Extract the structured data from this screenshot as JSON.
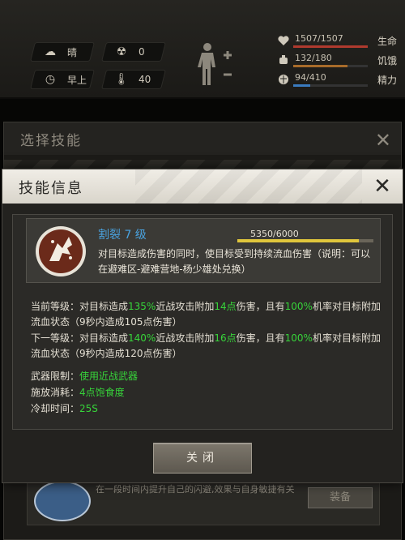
{
  "hud": {
    "weather": "晴",
    "radiation": "0",
    "time_of_day": "早上",
    "temperature": "40",
    "vitals": [
      {
        "label": "生命",
        "value": "1507/1507",
        "fill_fraction": 1.0,
        "color": "#b03a2e"
      },
      {
        "label": "饥饿",
        "value": "132/180",
        "fill_fraction": 0.733,
        "color": "#a86b2a"
      },
      {
        "label": "精力",
        "value": "94/410",
        "fill_fraction": 0.229,
        "color": "#3a7bbf"
      }
    ]
  },
  "background_dialog": {
    "title": "选择技能",
    "skill_desc": "在一段时间内提升自己的闪避,效果与自身敏捷有关",
    "equip_label": "装备"
  },
  "dialog": {
    "title": "技能信息",
    "skill_name": "割裂 7 级",
    "xp_text": "5350/6000",
    "xp_fraction": 0.892,
    "description": "对目标造成伤害的同时，使目标受到持续流血伤害（说明：可以在避难区-避难营地-杨少雄处兑换）",
    "current": {
      "label": "当前等级：",
      "p1": "对目标造成",
      "pct": "135%",
      "p2": "近战攻击附加",
      "dmg": "14点",
      "p3": "伤害，且有",
      "chance": "100%",
      "p4": "机率对目标附加流血状态（9秒内造成105点伤害）"
    },
    "next": {
      "label": "下一等级：",
      "p1": "对目标造成",
      "pct": "140%",
      "p2": "近战攻击附加",
      "dmg": "16点",
      "p3": "伤害，且有",
      "chance": "100%",
      "p4": "机率对目标附加流血状态（9秒内造成120点伤害）"
    },
    "weapon_label": "武器限制：",
    "weapon_value": "使用近战武器",
    "cost_label": "施放消耗：",
    "cost_value": "4点饱食度",
    "cooldown_label": "冷却时间：",
    "cooldown_value": "25S",
    "close_label": "关闭"
  },
  "colors": {
    "highlight": "#37d43a",
    "skill_name": "#4aa3e0",
    "xp_fill": "#e0c63c"
  }
}
